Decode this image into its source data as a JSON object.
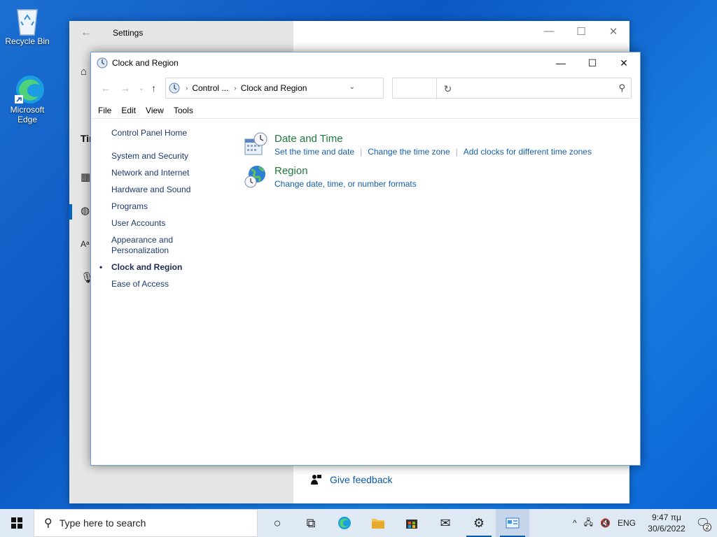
{
  "desktop": {
    "recycle_bin": "Recycle Bin",
    "edge": "Microsoft Edge"
  },
  "settings": {
    "title": "Settings",
    "partial_heading": "Tir",
    "feedback": "Give feedback"
  },
  "control_panel": {
    "title": "Clock and Region",
    "address": {
      "segment1": "Control ...",
      "segment2": "Clock and Region"
    },
    "search_placeholder": "",
    "menu": [
      "File",
      "Edit",
      "View",
      "Tools"
    ],
    "left_nav": {
      "home": "Control Panel Home",
      "items": [
        "System and Security",
        "Network and Internet",
        "Hardware and Sound",
        "Programs",
        "User Accounts",
        "Appearance and Personalization",
        "Clock and Region",
        "Ease of Access"
      ]
    },
    "categories": [
      {
        "title": "Date and Time",
        "links": [
          "Set the time and date",
          "Change the time zone",
          "Add clocks for different time zones"
        ]
      },
      {
        "title": "Region",
        "links": [
          "Change date, time, or number formats"
        ]
      }
    ]
  },
  "taskbar": {
    "search_placeholder": "Type here to search",
    "language": "ENG",
    "time": "9:47 πμ",
    "date": "30/6/2022",
    "notifications": "2"
  },
  "colors": {
    "link": "#1660a8",
    "category_title": "#1e7a3a",
    "desktop": "#0b57c4"
  }
}
